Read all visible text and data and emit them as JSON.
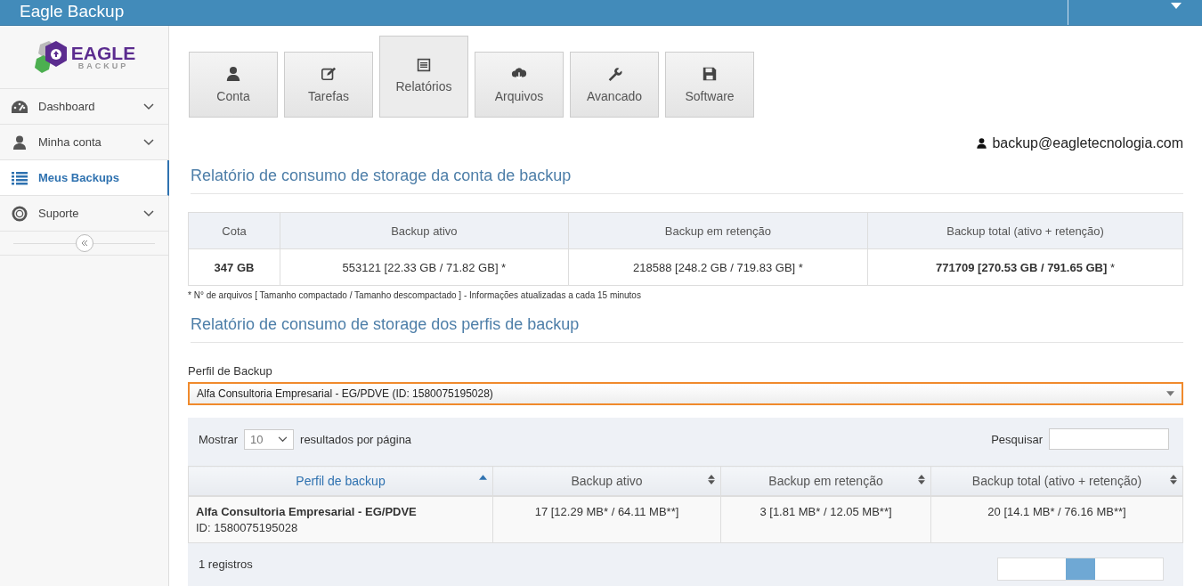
{
  "header": {
    "title": "Eagle Backup"
  },
  "sidebar": {
    "logo": {
      "name": "EAGLE",
      "sub": "BACKUP"
    },
    "items": [
      {
        "label": "Dashboard",
        "selected": false,
        "has_submenu": true
      },
      {
        "label": "Minha conta",
        "selected": false,
        "has_submenu": true
      },
      {
        "label": "Meus Backups",
        "selected": true,
        "has_submenu": false
      },
      {
        "label": "Suporte",
        "selected": false,
        "has_submenu": true
      }
    ]
  },
  "tabs": [
    {
      "label": "Conta",
      "selected": false
    },
    {
      "label": "Tarefas",
      "selected": false
    },
    {
      "label": "Relatórios",
      "selected": true
    },
    {
      "label": "Arquivos",
      "selected": false
    },
    {
      "label": "Avancado",
      "selected": false
    },
    {
      "label": "Software",
      "selected": false
    }
  ],
  "user_email": "backup@eagletecnologia.com",
  "account_report": {
    "title": "Relatório de consumo de storage da conta de backup",
    "columns": [
      "Cota",
      "Backup ativo",
      "Backup em retenção",
      "Backup total (ativo + retenção)"
    ],
    "row": [
      "347 GB",
      "553121 [22.33 GB / 71.82 GB] *",
      "218588 [248.2 GB / 719.83 GB] *",
      "**771709 [270.53 GB / 791.65 GB]** *"
    ],
    "note": "* N° de arquivos [ Tamanho compactado / Tamanho descompactado ] - Informações atualizadas a cada 15 minutos"
  },
  "profile_report": {
    "title": "Relatório de consumo de storage dos perfis de backup",
    "profile_label": "Perfil de Backup",
    "profile_value": "Alfa Consultoria Empresarial - EG/PDVE (ID: 1580075195028)",
    "profile_focused": true,
    "show_label": "Mostrar",
    "page_size": "10",
    "per_page_label": "resultados por página",
    "search_label": "Pesquisar",
    "columns": [
      {
        "label": "Perfil de backup",
        "sorted": true
      },
      {
        "label": "Backup ativo",
        "sorted": false
      },
      {
        "label": "Backup em retenção",
        "sorted": false
      },
      {
        "label": "Backup total (ativo + retenção)",
        "sorted": false
      }
    ],
    "rows": [
      {
        "cells": [
          {
            "name": "Alfa Consultoria Empresarial - EG/PDVE",
            "id": "ID: 1580075195028"
          },
          "17 [12.29 MB* / 64.11 MB**]",
          "3 [1.81 MB* / 12.05 MB**]",
          "20 [14.1 MB* / 76.16 MB**]"
        ]
      }
    ],
    "footer": "1 registros"
  }
}
